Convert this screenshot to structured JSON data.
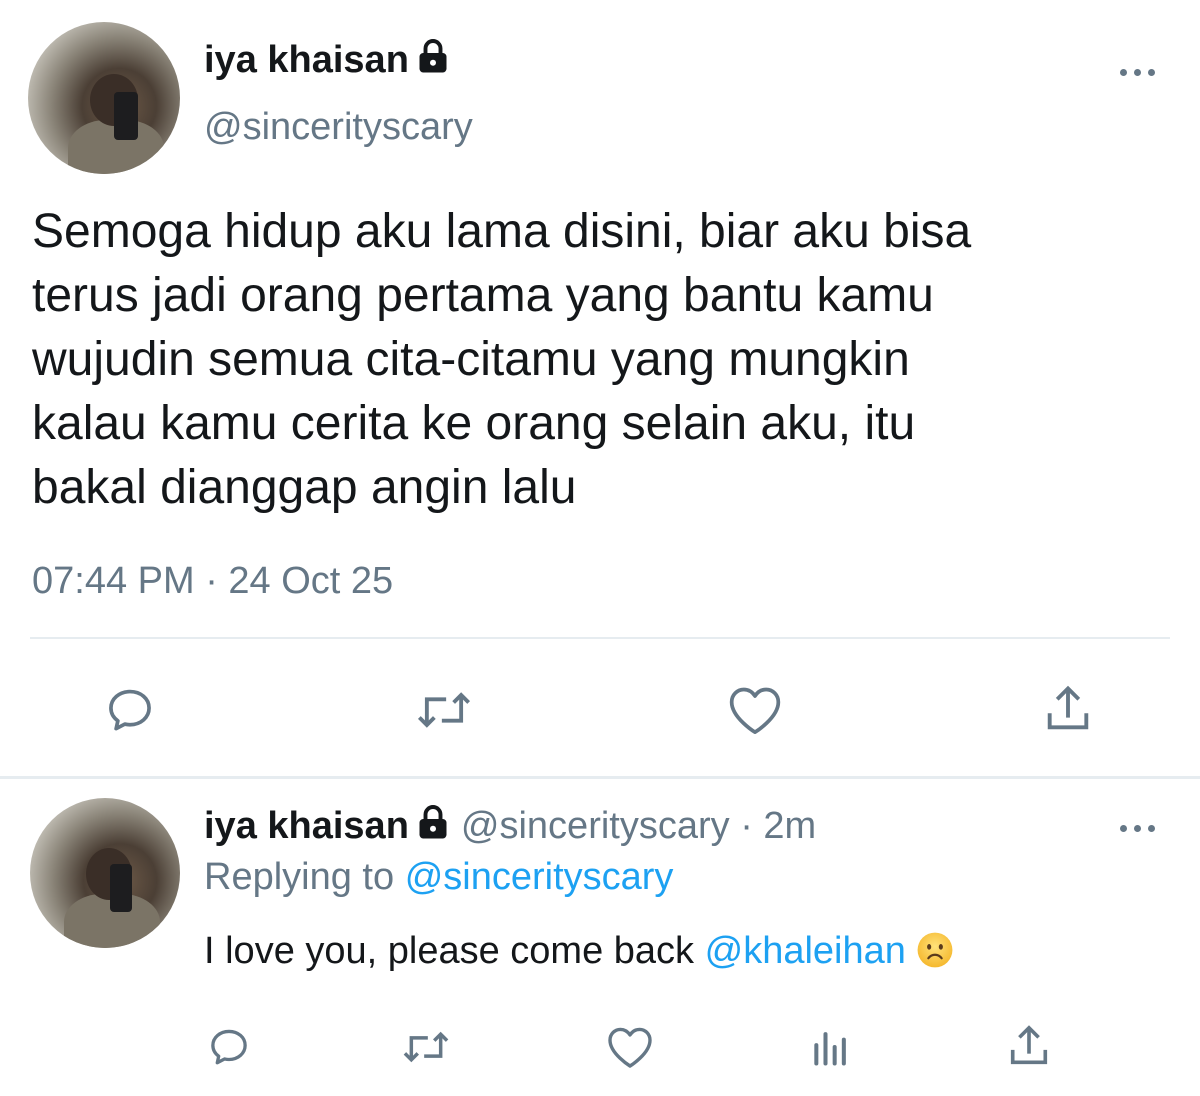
{
  "main_tweet": {
    "display_name": "iya khaisan",
    "handle": "@sincerityscary",
    "text_lines": [
      "Semoga hidup aku lama disini, biar aku bisa",
      "terus jadi orang pertama yang bantu kamu",
      "wujudin semua cita-citamu yang mungkin",
      "kalau kamu cerita ke orang selain aku, itu",
      "bakal dianggap angin lalu"
    ],
    "timestamp": "07:44 PM · 24 Oct 25",
    "actions": [
      "reply-icon",
      "retweet-icon",
      "like-icon",
      "share-icon"
    ]
  },
  "reply_tweet": {
    "display_name": "iya khaisan",
    "handle_time": "@sincerityscary · 2m",
    "replying_prefix": "Replying to",
    "replying_to": "@sincerityscary",
    "text": "I love you, please come back",
    "mention": "@khaleihan",
    "emoji": "slightly-frowning-face",
    "actions": [
      "reply-icon",
      "retweet-icon",
      "like-icon",
      "analytics-icon",
      "share-icon"
    ]
  },
  "colors": {
    "primary_text": "#14171a",
    "secondary_text": "#657786",
    "link": "#1da1f2",
    "divider": "#e6ecf0"
  }
}
